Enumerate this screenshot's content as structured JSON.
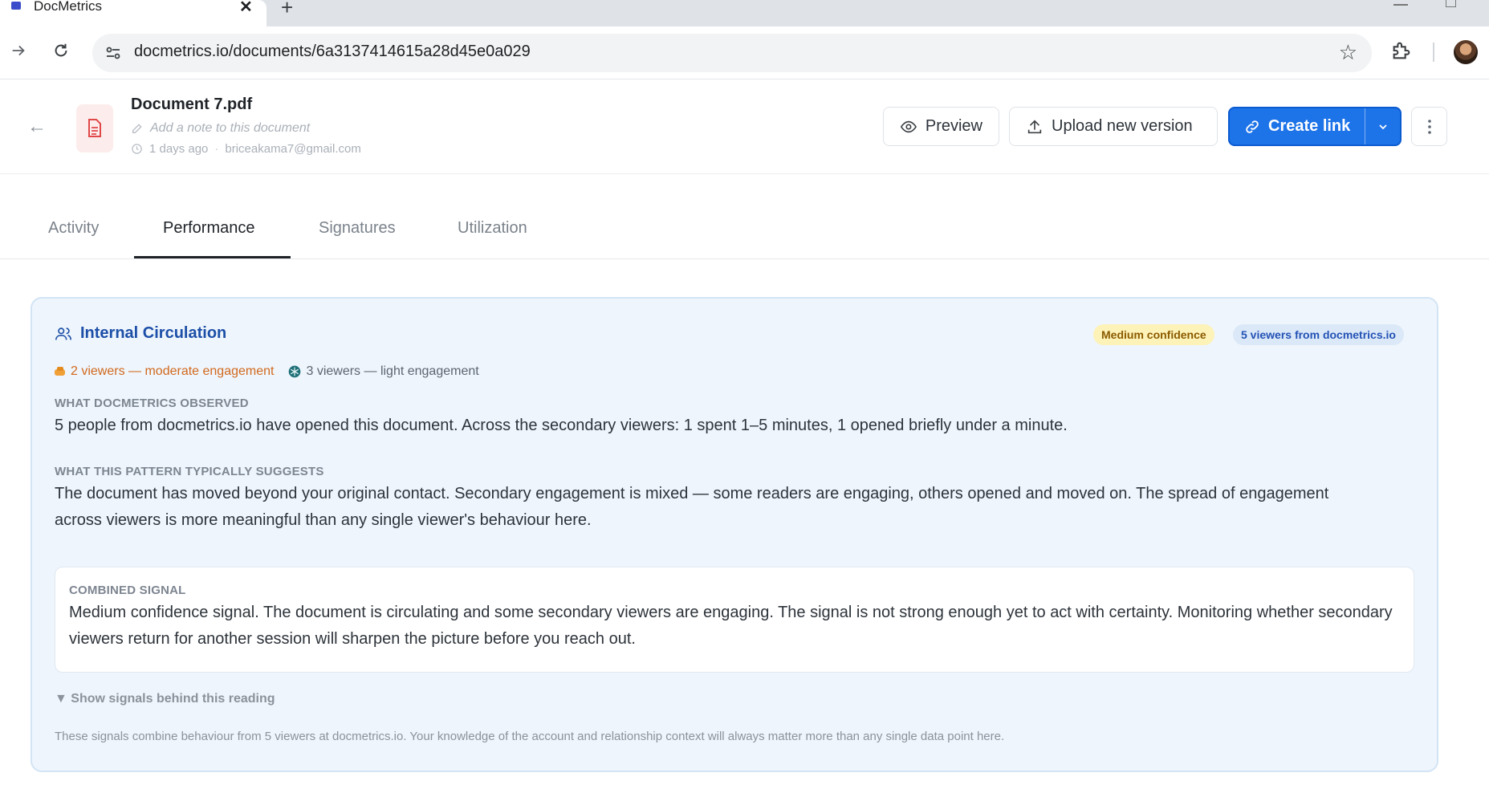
{
  "browser": {
    "tab_title": "DocMetrics",
    "url": "docmetrics.io/documents/6a3137414615a28d45e0a029"
  },
  "document": {
    "title": "Document 7.pdf",
    "note_placeholder": "Add a note to this document",
    "time_ago": "1 days ago",
    "owner_email": "briceakama7@gmail.com"
  },
  "actions": {
    "preview": "Preview",
    "upload": "Upload new version",
    "create_link": "Create link"
  },
  "tabs": [
    {
      "label": "Activity"
    },
    {
      "label": "Performance",
      "active": true
    },
    {
      "label": "Signatures"
    },
    {
      "label": "Utilization"
    }
  ],
  "card": {
    "title": "Internal Circulation",
    "confidence_badge": "Medium confidence",
    "viewers_badge": "5 viewers from docmetrics.io",
    "moderate_engagement": "2 viewers — moderate engagement",
    "light_engagement": "3 viewers — light engagement",
    "observed_label": "WHAT DOCMETRICS OBSERVED",
    "observed_text": "5 people from docmetrics.io have opened this document. Across the secondary viewers: 1 spent 1–5 minutes, 1 opened briefly under a minute.",
    "pattern_label": "WHAT THIS PATTERN TYPICALLY SUGGESTS",
    "pattern_text": "The document has moved beyond your original contact. Secondary engagement is mixed — some readers are engaging, others opened and moved on. The spread of engagement across viewers is more meaningful than any single viewer's behaviour here.",
    "combined_label": "COMBINED SIGNAL",
    "combined_text": "Medium confidence signal. The document is circulating and some secondary viewers are engaging. The signal is not strong enough yet to act with certainty. Monitoring whether secondary viewers return for another session will sharpen the picture before you reach out.",
    "show_signals": "▼ Show signals behind this reading",
    "footnote": "These signals combine behaviour from 5 viewers at docmetrics.io. Your knowledge of the account and relationship context will always matter more than any single data point here."
  },
  "colors": {
    "primary": "#1d73e8",
    "card_bg": "#eef5fc",
    "card_title": "#1d4fa8",
    "moderate": "#d2691e",
    "badge_conf_bg": "#fdf2b7",
    "badge_viewers_bg": "#dbe8f8"
  }
}
